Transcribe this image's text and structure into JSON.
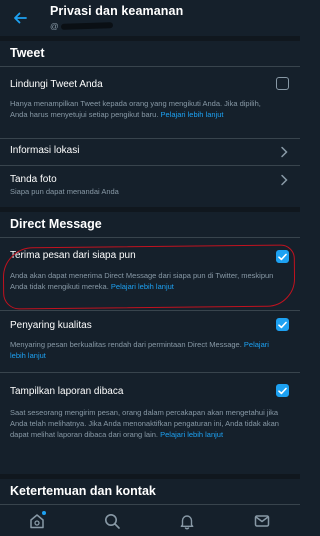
{
  "header": {
    "title": "Privasi dan keamanan",
    "handle_prefix": "@"
  },
  "sections": {
    "tweet": {
      "title": "Tweet"
    },
    "dm": {
      "title": "Direct Message"
    },
    "discover": {
      "title": "Ketertemuan dan kontak"
    }
  },
  "items": {
    "protect": {
      "title": "Lindungi Tweet Anda",
      "desc": "Hanya menampilkan Tweet kepada orang yang mengikuti Anda. Jika dipilih, Anda harus menyetujui setiap pengikut baru.",
      "link": "Pelajari lebih lanjut",
      "checked": false
    },
    "location": {
      "title": "Informasi lokasi"
    },
    "photo": {
      "title": "Tanda foto",
      "desc": "Siapa pun dapat menandai Anda"
    },
    "receive_dm": {
      "title": "Terima pesan dari siapa pun",
      "desc": "Anda akan dapat menerima Direct Message dari siapa pun di Twitter, meskipun Anda tidak mengikuti mereka.",
      "link": "Pelajari lebih lanjut",
      "checked": true
    },
    "quality": {
      "title": "Penyaring kualitas",
      "desc": "Menyaring pesan berkualitas rendah dari permintaan Direct Message.",
      "link": "Pelajari lebih lanjut",
      "checked": true
    },
    "read_receipts": {
      "title": "Tampilkan laporan dibaca",
      "desc": "Saat seseorang mengirim pesan, orang dalam percakapan akan mengetahui jika Anda telah melihatnya. Jika Anda menonaktifkan pengaturan ini, Anda tidak akan dapat melihat laporan dibaca dari orang lain.",
      "link": "Pelajari lebih lanjut",
      "checked": true
    }
  },
  "nav": {
    "icons": [
      "home-icon",
      "search-icon",
      "notifications-icon",
      "messages-icon"
    ],
    "active": "home-icon"
  },
  "colors": {
    "background": "#15202b",
    "accent": "#1da1f2",
    "muted": "#8899a6",
    "annotation": "#c1121f"
  }
}
